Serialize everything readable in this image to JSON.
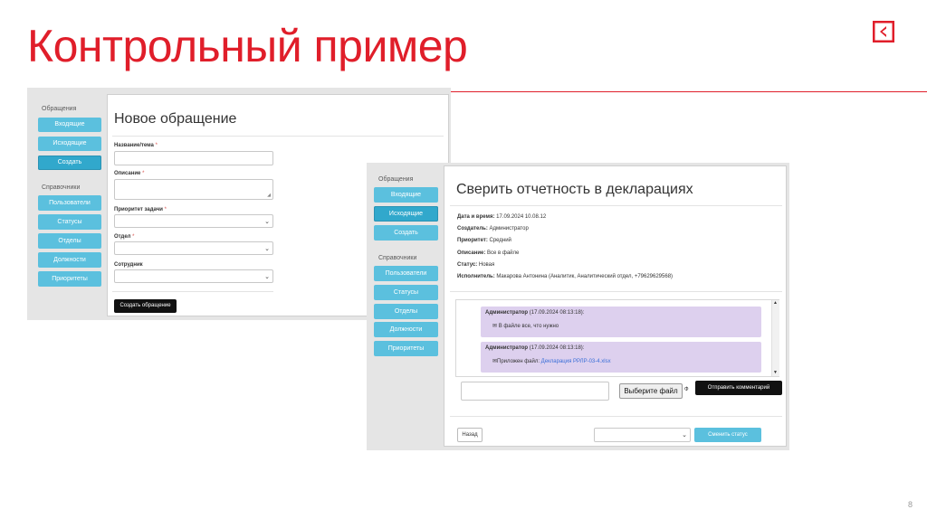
{
  "slide": {
    "title": "Контрольный пример",
    "page_number": "8",
    "accent_color": "#e01e2a"
  },
  "form_screen": {
    "sidebar": {
      "section1": "Обращения",
      "items1": [
        "Входящие",
        "Исходящие",
        "Создать"
      ],
      "active1": 2,
      "section2": "Справочники",
      "items2": [
        "Пользователи",
        "Статусы",
        "Отделы",
        "Должности",
        "Приоритеты"
      ]
    },
    "title": "Новое обращение",
    "fields": [
      {
        "label": "Название/тема",
        "required": "*",
        "type": "text",
        "value": ""
      },
      {
        "label": "Описание",
        "required": "*",
        "type": "textarea",
        "value": ""
      },
      {
        "label": "Приоритет задачи",
        "required": "*",
        "type": "select",
        "value": ""
      },
      {
        "label": "Отдел",
        "required": "*",
        "type": "select",
        "value": ""
      },
      {
        "label": "Сотрудник",
        "required": "",
        "type": "select",
        "value": ""
      }
    ],
    "submit_label": "Создать обращение"
  },
  "detail_screen": {
    "sidebar": {
      "section1": "Обращения",
      "items1": [
        "Входящие",
        "Исходящие",
        "Создать"
      ],
      "active1": 1,
      "section2": "Справочники",
      "items2": [
        "Пользователи",
        "Статусы",
        "Отделы",
        "Должности",
        "Приоритеты"
      ]
    },
    "title": "Сверить отчетность в декларациях",
    "info": [
      {
        "label": "Дата и время:",
        "value": "17.09.2024 10.08.12"
      },
      {
        "label": "Создатель:",
        "value": "Администратор"
      },
      {
        "label": "Приоритет:",
        "value": "Средний"
      },
      {
        "label": "Описание:",
        "value": "Все в файле"
      },
      {
        "label": "Статус:",
        "value": "Новая"
      },
      {
        "label": "Исполнитель:",
        "value": "Макарова Антонина (Аналитик, Аналитический отдел, +79629629568)"
      }
    ],
    "comments": [
      {
        "author": "Администратор",
        "time": "(17.09.2024 08:13:18):",
        "text": "✉ В файле все, что нужно"
      },
      {
        "author": "Администратор",
        "time": "(17.09.2024 08:13:18):",
        "text": "✉Приложен файл: ",
        "link": "Декларация РРЛР-03-4.xlsx"
      }
    ],
    "comment_value": "",
    "file_button": "Выберите файл",
    "file_suffix": "Ф",
    "send_comment": "Отправить комментарий",
    "back": "Назад",
    "status_select_value": "",
    "change_status": "Сменить статус"
  }
}
